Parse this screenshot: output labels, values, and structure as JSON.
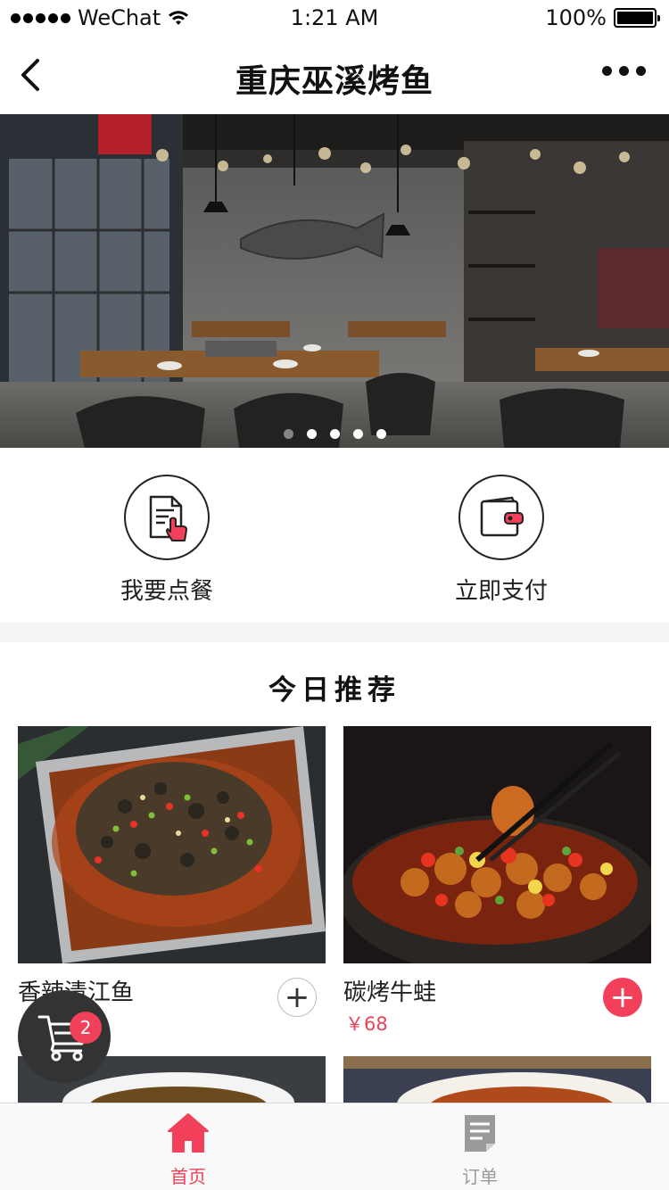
{
  "status_bar": {
    "carrier": "WeChat",
    "time": "1:21 AM",
    "battery": "100%"
  },
  "nav": {
    "title": "重庆巫溪烤鱼"
  },
  "banner": {
    "slide_count": 5,
    "active_index": 1
  },
  "actions": [
    {
      "label": "我要点餐",
      "icon": "order-icon"
    },
    {
      "label": "立即支付",
      "icon": "wallet-icon"
    }
  ],
  "recommend": {
    "title": "今日推荐",
    "items": [
      {
        "name": "香辣清江鱼",
        "price": "￥",
        "added": false
      },
      {
        "name": "碳烤牛蛙",
        "price": "￥68",
        "added": true
      }
    ]
  },
  "cart": {
    "count": "2"
  },
  "tabs": [
    {
      "label": "首页",
      "icon": "home-icon",
      "active": true,
      "color": "#f2405a"
    },
    {
      "label": "订单",
      "icon": "order-list-icon",
      "active": false,
      "color": "#9a9a9a"
    }
  ],
  "colors": {
    "accent": "#f2405a",
    "price": "#e8445b"
  }
}
